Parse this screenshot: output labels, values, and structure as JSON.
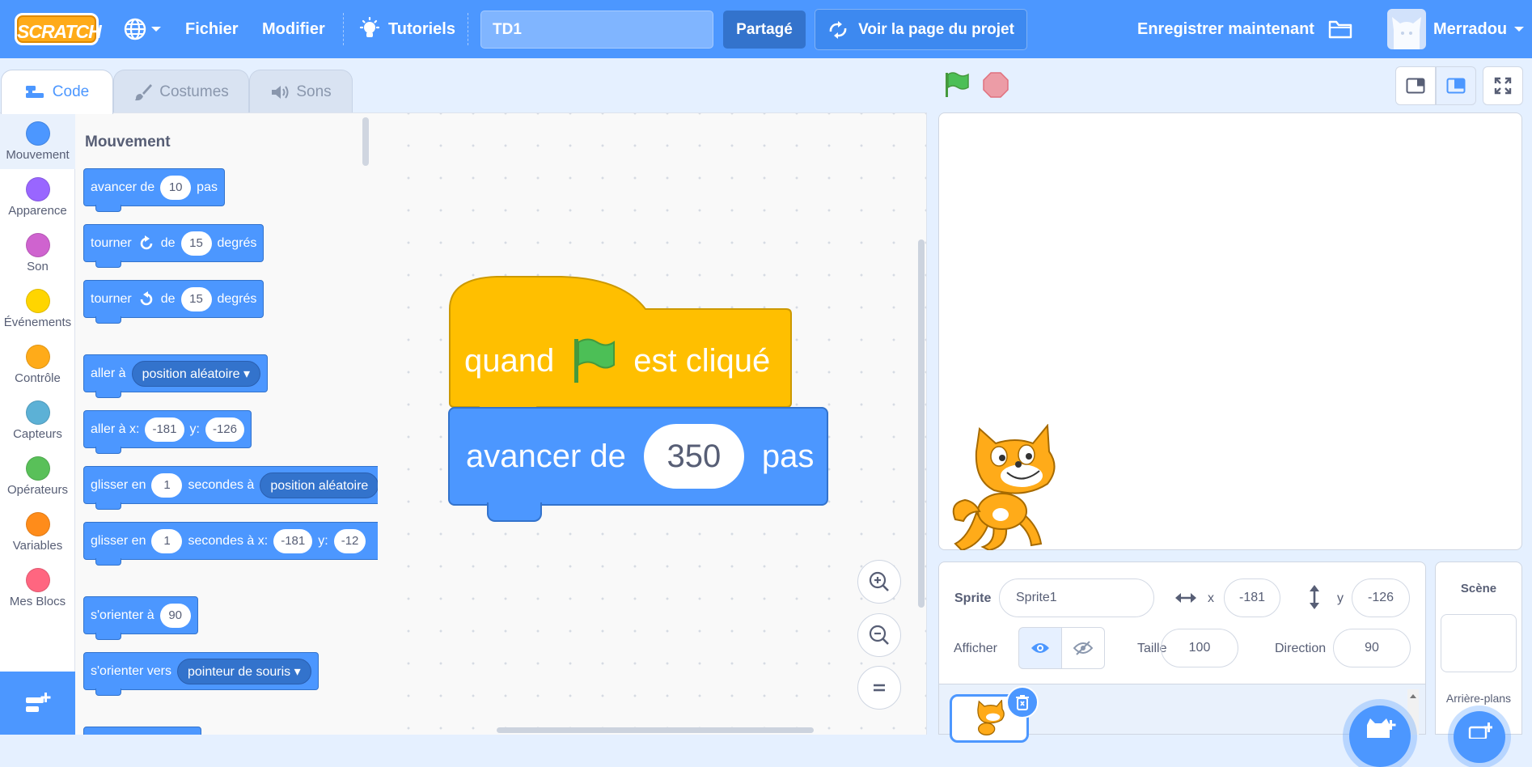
{
  "app": {
    "logo_text": "SCRATCH"
  },
  "menubar": {
    "file": "Fichier",
    "edit": "Modifier",
    "tutorials": "Tutoriels",
    "project_title": "TD1",
    "share": "Partagé",
    "see_project_page": "Voir la page du projet",
    "save_now": "Enregistrer maintenant",
    "username": "Merradou"
  },
  "tabs": {
    "code": "Code",
    "costumes": "Costumes",
    "sounds": "Sons"
  },
  "categories": [
    {
      "label": "Mouvement",
      "color": "#4c97ff"
    },
    {
      "label": "Apparence",
      "color": "#9966ff"
    },
    {
      "label": "Son",
      "color": "#cf63cf"
    },
    {
      "label": "Événements",
      "color": "#ffd500"
    },
    {
      "label": "Contrôle",
      "color": "#ffab19"
    },
    {
      "label": "Capteurs",
      "color": "#5cb1d6"
    },
    {
      "label": "Opérateurs",
      "color": "#59c059"
    },
    {
      "label": "Variables",
      "color": "#ff8c1a"
    },
    {
      "label": "Mes Blocs",
      "color": "#ff6680"
    }
  ],
  "palette": {
    "heading": "Mouvement",
    "move": {
      "t1": "avancer de",
      "v": "10",
      "t2": "pas"
    },
    "turn_right": {
      "t1": "tourner",
      "t2": "de",
      "v": "15",
      "t3": "degrés"
    },
    "turn_left": {
      "t1": "tourner",
      "t2": "de",
      "v": "15",
      "t3": "degrés"
    },
    "goto": {
      "t1": "aller à",
      "menu": "position aléatoire"
    },
    "goto_xy": {
      "t1": "aller à x:",
      "x": "-181",
      "t2": "y:",
      "y": "-126"
    },
    "glide": {
      "t1": "glisser en",
      "v": "1",
      "t2": "secondes à",
      "menu": "position aléatoire"
    },
    "glide_xy": {
      "t1": "glisser en",
      "v": "1",
      "t2": "secondes à x:",
      "x": "-181",
      "t3": "y:",
      "y": "-12"
    },
    "point_dir": {
      "t1": "s'orienter à",
      "v": "90"
    },
    "point_towards": {
      "t1": "s'orienter vers",
      "menu": "pointeur de souris"
    }
  },
  "script": {
    "hat": {
      "t1": "quand",
      "t2": "est cliqué"
    },
    "move": {
      "t1": "avancer de",
      "v": "350",
      "t2": "pas"
    }
  },
  "sprite_info": {
    "sprite_label": "Sprite",
    "sprite_name": "Sprite1",
    "x_label": "x",
    "x": "-181",
    "y_label": "y",
    "y": "-126",
    "show_label": "Afficher",
    "size_label": "Taille",
    "size": "100",
    "direction_label": "Direction",
    "direction": "90"
  },
  "stage_pane": {
    "title": "Scène",
    "backdrops": "Arrière-plans"
  },
  "colors": {
    "accent": "#4c97ff",
    "menubar": "#4c97ff",
    "events": "#ffbf00",
    "motion": "#4c97ff"
  }
}
